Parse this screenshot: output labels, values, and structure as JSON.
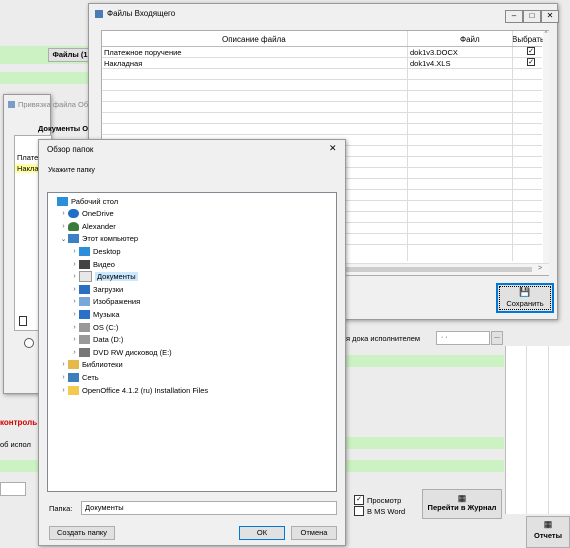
{
  "background": {
    "files_button": "Файлы (1",
    "parent_dialog_title": "Привязка файла Об",
    "parent_dialog_header": "Документы Об",
    "parent_list": [
      "Плате",
      "Наклад"
    ],
    "executor_label": "я дока исполнителем",
    "executor_field": "· ·",
    "control_label": "контроль",
    "exec_label": "об испол",
    "preview_label": "Просмотр",
    "word_label": "В MS Word",
    "journal_button": "Перейти в Журнал",
    "reports_label": "Отчеты"
  },
  "incoming": {
    "title": "Файлы Входящего",
    "columns": [
      "Описание файла",
      "Файл",
      "Выбрать"
    ],
    "rows": [
      {
        "description": "Платежное поручение",
        "file": "dok1v3.DOCX",
        "checked": true
      },
      {
        "description": "Накладная",
        "file": "dok1v4.XLS",
        "checked": true
      }
    ],
    "save_button": "Сохранить"
  },
  "browse": {
    "title": "Обзор папок",
    "prompt": "Укажите папку",
    "tree": [
      {
        "label": "Рабочий стол",
        "icon": "desktop-icon",
        "level": 0,
        "chevron": ""
      },
      {
        "label": "OneDrive",
        "icon": "cloud-icon",
        "level": 1,
        "chevron": ">"
      },
      {
        "label": "Alexander",
        "icon": "user-icon",
        "level": 1,
        "chevron": ">"
      },
      {
        "label": "Этот компьютер",
        "icon": "computer-icon",
        "level": 1,
        "chevron": "v"
      },
      {
        "label": "Desktop",
        "icon": "desktop-icon",
        "level": 2,
        "chevron": ">"
      },
      {
        "label": "Видео",
        "icon": "video-icon",
        "level": 2,
        "chevron": ">"
      },
      {
        "label": "Документы",
        "icon": "documents-icon",
        "level": 2,
        "chevron": ">",
        "selected": true
      },
      {
        "label": "Загрузки",
        "icon": "download-icon",
        "level": 2,
        "chevron": ">"
      },
      {
        "label": "Изображения",
        "icon": "pictures-icon",
        "level": 2,
        "chevron": ">"
      },
      {
        "label": "Музыка",
        "icon": "music-icon",
        "level": 2,
        "chevron": ">"
      },
      {
        "label": "OS (C:)",
        "icon": "drive-icon",
        "level": 2,
        "chevron": ">"
      },
      {
        "label": "Data (D:)",
        "icon": "drive-icon",
        "level": 2,
        "chevron": ">"
      },
      {
        "label": "DVD RW дисковод (E:)",
        "icon": "dvd-icon",
        "level": 2,
        "chevron": ">"
      },
      {
        "label": "Библиотеки",
        "icon": "library-icon",
        "level": 1,
        "chevron": ">"
      },
      {
        "label": "Сеть",
        "icon": "network-icon",
        "level": 1,
        "chevron": ">"
      },
      {
        "label": "OpenOffice 4.1.2 (ru) Installation Files",
        "icon": "folder-icon",
        "level": 1,
        "chevron": ">"
      }
    ],
    "folder_label": "Папка:",
    "folder_value": "Документы",
    "new_folder_button": "Создать папку",
    "ok_button": "ОК",
    "cancel_button": "Отмена"
  },
  "colors": {
    "green": "#ccf2c4",
    "selected": "#cce8ff",
    "accent_border": "#0078d7"
  }
}
